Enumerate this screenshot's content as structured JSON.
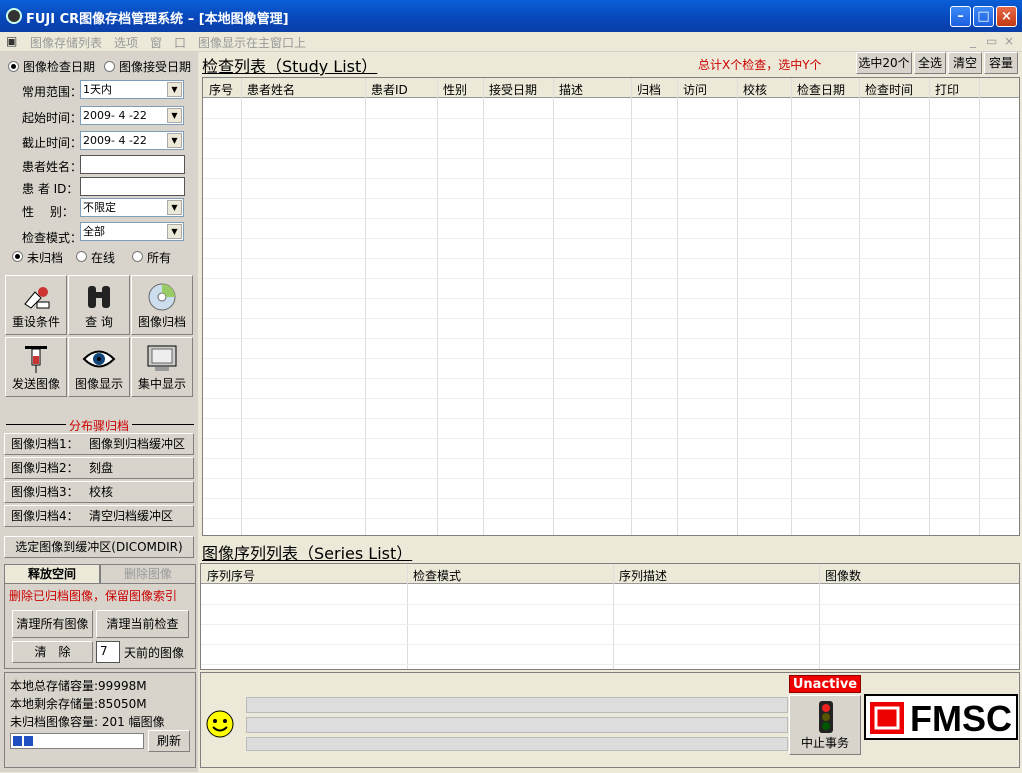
{
  "window": {
    "title": "FUJI CR图像存档管理系统 – [本地图像管理]"
  },
  "menu": {
    "items": [
      "图像存储列表",
      "选项",
      "窗",
      "口",
      "图像显示在主窗口上"
    ]
  },
  "filter": {
    "radio_exam_date": "图像检查日期",
    "radio_receive_date": "图像接受日期",
    "common_range_label": "常用范围：",
    "common_range_value": "1天内",
    "start_label": "起始时间：",
    "start_value": "2009- 4 -22",
    "end_label": "截止时间：",
    "end_value": "2009- 4 -22",
    "name_label": "患者姓名：",
    "id_label": "患 者 ID：",
    "sex_label": "性　 别：",
    "sex_value": "不限定",
    "mode_label": "检查模式：",
    "mode_value": "全部",
    "arch_unarchived": "未归档",
    "arch_online": "在线",
    "arch_all": "所有"
  },
  "tools": {
    "reset": "重设条件",
    "query": "查 询",
    "archive": "图像归档",
    "send": "发送图像",
    "display": "图像显示",
    "central": "集中显示"
  },
  "steps": {
    "title": "分布骤归档",
    "s1a": "图像归档1：",
    "s1b": "图像到归档缓冲区",
    "s2a": "图像归档2：",
    "s2b": "刻盘",
    "s3a": "图像归档3：",
    "s3b": "校核",
    "s4a": "图像归档4：",
    "s4b": "清空归档缓冲区"
  },
  "dicomdir_btn": "选定图像到缓冲区(DICOMDIR)",
  "cleanup": {
    "tab_free": "释放空间",
    "tab_delete": "删除图像",
    "note": "删除已归档图像，保留图像索引",
    "clear_all": "清理所有图像",
    "clear_current": "清理当前检查",
    "clear": "清　除",
    "days_value": "7",
    "days_suffix": "天前的图像"
  },
  "storage": {
    "total": "本地总存储容量:99998M",
    "remaining": "本地剩余存储量:85050M",
    "unarchived": "未归档图像容量: 201 幅图像",
    "refresh": "刷新"
  },
  "study": {
    "title": "检查列表（Study List）",
    "summary": "总计X个检查，选中Y个",
    "btn_sel20": "选中20个",
    "btn_all": "全选",
    "btn_clear": "清空",
    "btn_cap": "容量",
    "columns": [
      "序号",
      "患者姓名",
      "患者ID",
      "性别",
      "接受日期",
      "描述",
      "归档",
      "访问",
      "校核",
      "检查日期",
      "检查时间",
      "打印"
    ]
  },
  "series": {
    "title": "图像序列列表（Series List）",
    "columns": [
      "序列序号",
      "检查模式",
      "序列描述",
      "图像数"
    ]
  },
  "bottom": {
    "unactive": "Unactive",
    "stop_tx": "中止事务",
    "logo": "FMSC"
  },
  "colors": {
    "accent_red": "#cc0000",
    "title_blue": "#0a5fd8"
  }
}
